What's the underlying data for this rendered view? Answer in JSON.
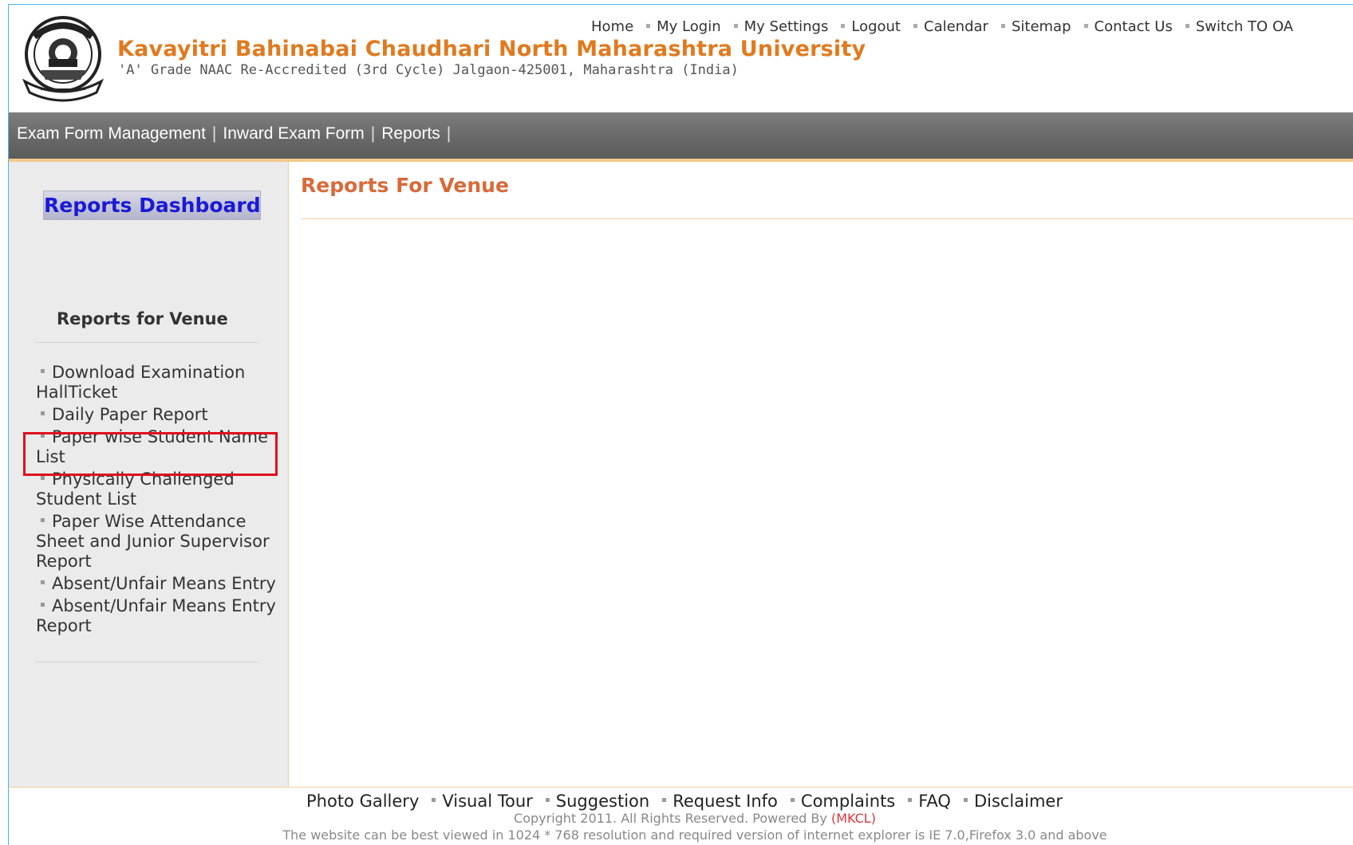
{
  "header": {
    "title": "Kavayitri Bahinabai Chaudhari North Maharashtra University",
    "subtitle": "'A' Grade NAAC Re-Accredited (3rd Cycle) Jalgaon-425001, Maharashtra (India)",
    "top_links": [
      "Home",
      "My Login",
      "My Settings",
      "Logout",
      "Calendar",
      "Sitemap",
      "Contact Us",
      "Switch TO OA"
    ]
  },
  "nav": {
    "items": [
      "Exam Form Management",
      "Inward Exam Form",
      "Reports"
    ]
  },
  "sidebar": {
    "dashboard_button": "Reports Dashboard",
    "heading": "Reports for Venue",
    "items": [
      "Download Examination HallTicket",
      "Daily Paper Report",
      "Paper wise Student Name List",
      "Physically Challenged Student List",
      "Paper Wise Attendance Sheet and Junior Supervisor Report",
      "Absent/Unfair Means Entry",
      "Absent/Unfair Means Entry Report"
    ]
  },
  "main": {
    "title": "Reports For Venue"
  },
  "footer": {
    "links": [
      "Photo Gallery",
      "Visual Tour",
      "Suggestion",
      "Request Info",
      "Complaints",
      "FAQ",
      "Disclaimer"
    ],
    "copyright_prefix": "Copyright 2011. All Rights Reserved. Powered By",
    "copyright_link": "(MKCL)",
    "best_view": "The website can be best viewed in 1024 * 768 resolution and required version of internet explorer is IE 7.0,Firefox 3.0 and above"
  },
  "colors": {
    "title_orange": "#e07a1f",
    "highlight_red": "#e0101e",
    "nav_gray": "#6a6a6a",
    "dashboard_blue": "#1a1ad6"
  }
}
